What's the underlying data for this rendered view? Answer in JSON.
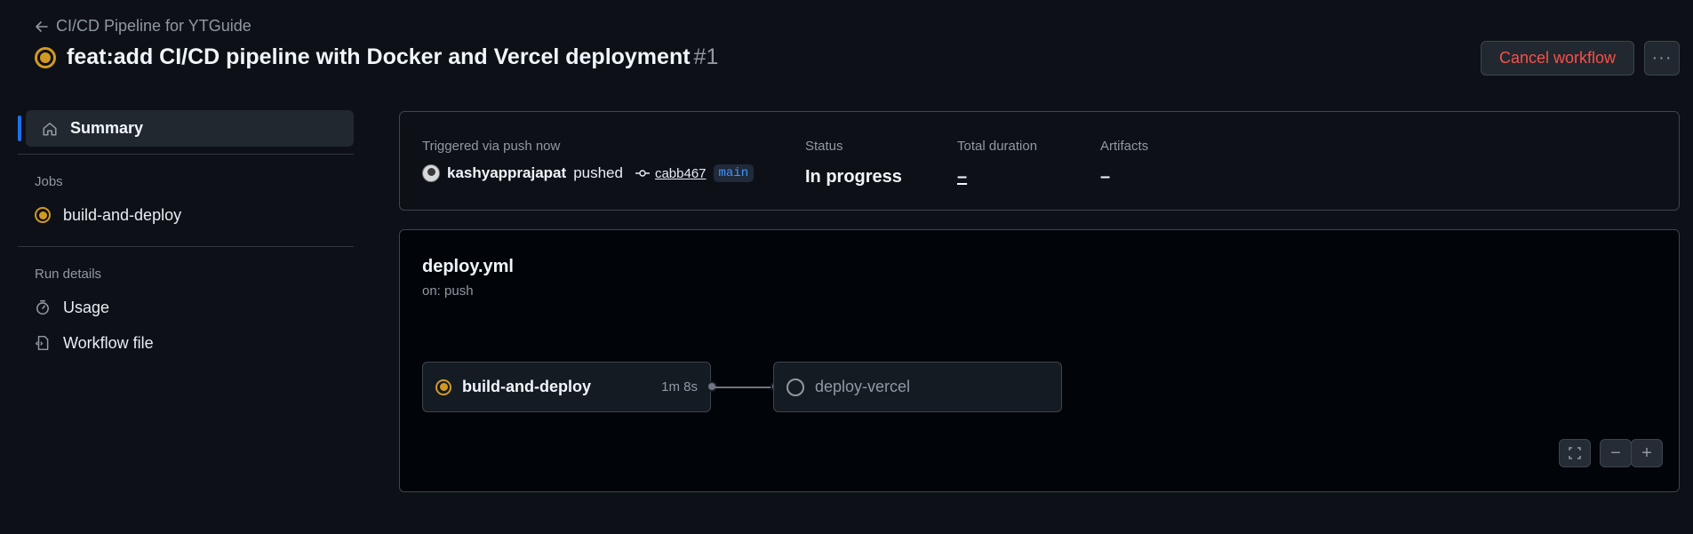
{
  "header": {
    "back_label": "CI/CD Pipeline for YTGuide",
    "title": "feat:add CI/CD pipeline with Docker and Vercel deployment",
    "run_number": "#1",
    "cancel_label": "Cancel workflow",
    "more_label": "···"
  },
  "sidebar": {
    "summary_label": "Summary",
    "jobs_heading": "Jobs",
    "jobs": [
      {
        "label": "build-and-deploy",
        "status": "in_progress"
      }
    ],
    "run_details_heading": "Run details",
    "run_details": [
      {
        "label": "Usage",
        "icon": "stopwatch-icon"
      },
      {
        "label": "Workflow file",
        "icon": "file-code-icon"
      }
    ]
  },
  "summary": {
    "trigger_label": "Triggered via push now",
    "user": "kashyapprajapat",
    "action": "pushed",
    "commit": "cabb467",
    "branch": "main",
    "status_label": "Status",
    "status_value": "In progress",
    "duration_label": "Total duration",
    "duration_value": "–",
    "artifacts_label": "Artifacts",
    "artifacts_value": "–"
  },
  "graph": {
    "file": "deploy.yml",
    "trigger": "on: push",
    "jobs": [
      {
        "name": "build-and-deploy",
        "time": "1m 8s",
        "status": "in_progress"
      },
      {
        "name": "deploy-vercel",
        "time": "",
        "status": "pending"
      }
    ],
    "controls": {
      "minus": "−",
      "plus": "+"
    }
  },
  "colors": {
    "background": "#0d1117",
    "in_progress": "#d29922",
    "danger": "#f85149",
    "accent": "#1f6feb",
    "branch_text": "#4493f8"
  }
}
